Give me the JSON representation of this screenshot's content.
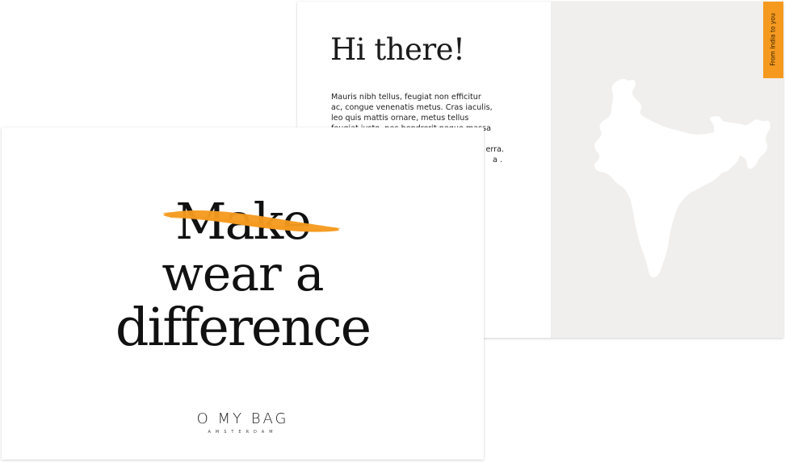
{
  "back_card": {
    "title": "Hi there!",
    "body_lines": [
      "Mauris nibh tellus, feugiat non efficitur",
      "ac, congue venenatis metus. Cras iaculis,",
      "leo quis mattis ornare, metus tellus",
      "feugiat justo, nec hendrerit neque massa",
      "",
      "erra.",
      "a ."
    ],
    "tab_text": "From India to you",
    "tab_color": "#f59a1f",
    "map_panel_color": "#f1efed",
    "map_icon": "india-map"
  },
  "front_card": {
    "headline_struck": "Make",
    "headline_line2": "wear a",
    "headline_line3": "difference",
    "brush_color": "#f59a1f",
    "logo_name": "O MY BAG",
    "logo_city": "AMSTERDAM"
  }
}
